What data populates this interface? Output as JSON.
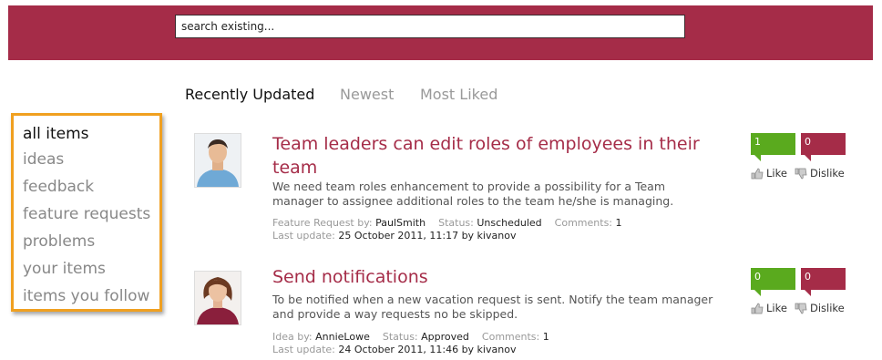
{
  "search": {
    "placeholder": "search existing..."
  },
  "tabs": [
    {
      "label": "Recently Updated",
      "active": true
    },
    {
      "label": "Newest",
      "active": false
    },
    {
      "label": "Most Liked",
      "active": false
    }
  ],
  "sidebar": {
    "items": [
      {
        "label": "all items",
        "active": true
      },
      {
        "label": "ideas"
      },
      {
        "label": "feedback"
      },
      {
        "label": "feature requests"
      },
      {
        "label": "problems"
      },
      {
        "label": "your items"
      },
      {
        "label": "items you follow"
      }
    ]
  },
  "items": [
    {
      "title": "Team leaders can edit roles of employees in their team",
      "description": "We need team roles enhancement to provide a possibility for a Team manager to assignee additional roles to the team he/she is managing.",
      "type_label": "Feature Request by:",
      "author": "PaulSmith",
      "status_label": "Status:",
      "status": "Unscheduled",
      "comments_label": "Comments:",
      "comments": "1",
      "last_update_label": "Last update:",
      "last_update": "25 October 2011, 11:17 by kivanov",
      "likes": "1",
      "dislikes": "0",
      "like_label": "Like",
      "dislike_label": "Dislike"
    },
    {
      "title": "Send notifications",
      "description": "To be notified when a new vacation request is sent. Notify the team manager and provide a way requests no be skipped.",
      "type_label": "Idea by:",
      "author": "AnnieLowe",
      "status_label": "Status:",
      "status": "Approved",
      "comments_label": "Comments:",
      "comments": "1",
      "last_update_label": "Last update:",
      "last_update": "24 October 2011, 11:46 by kivanov",
      "likes": "0",
      "dislikes": "0",
      "like_label": "Like",
      "dislike_label": "Dislike"
    }
  ],
  "colors": {
    "header": "#a52c48",
    "like": "#5aaa1e",
    "dislike": "#a52c48",
    "sidebar_border": "#f0a020"
  }
}
